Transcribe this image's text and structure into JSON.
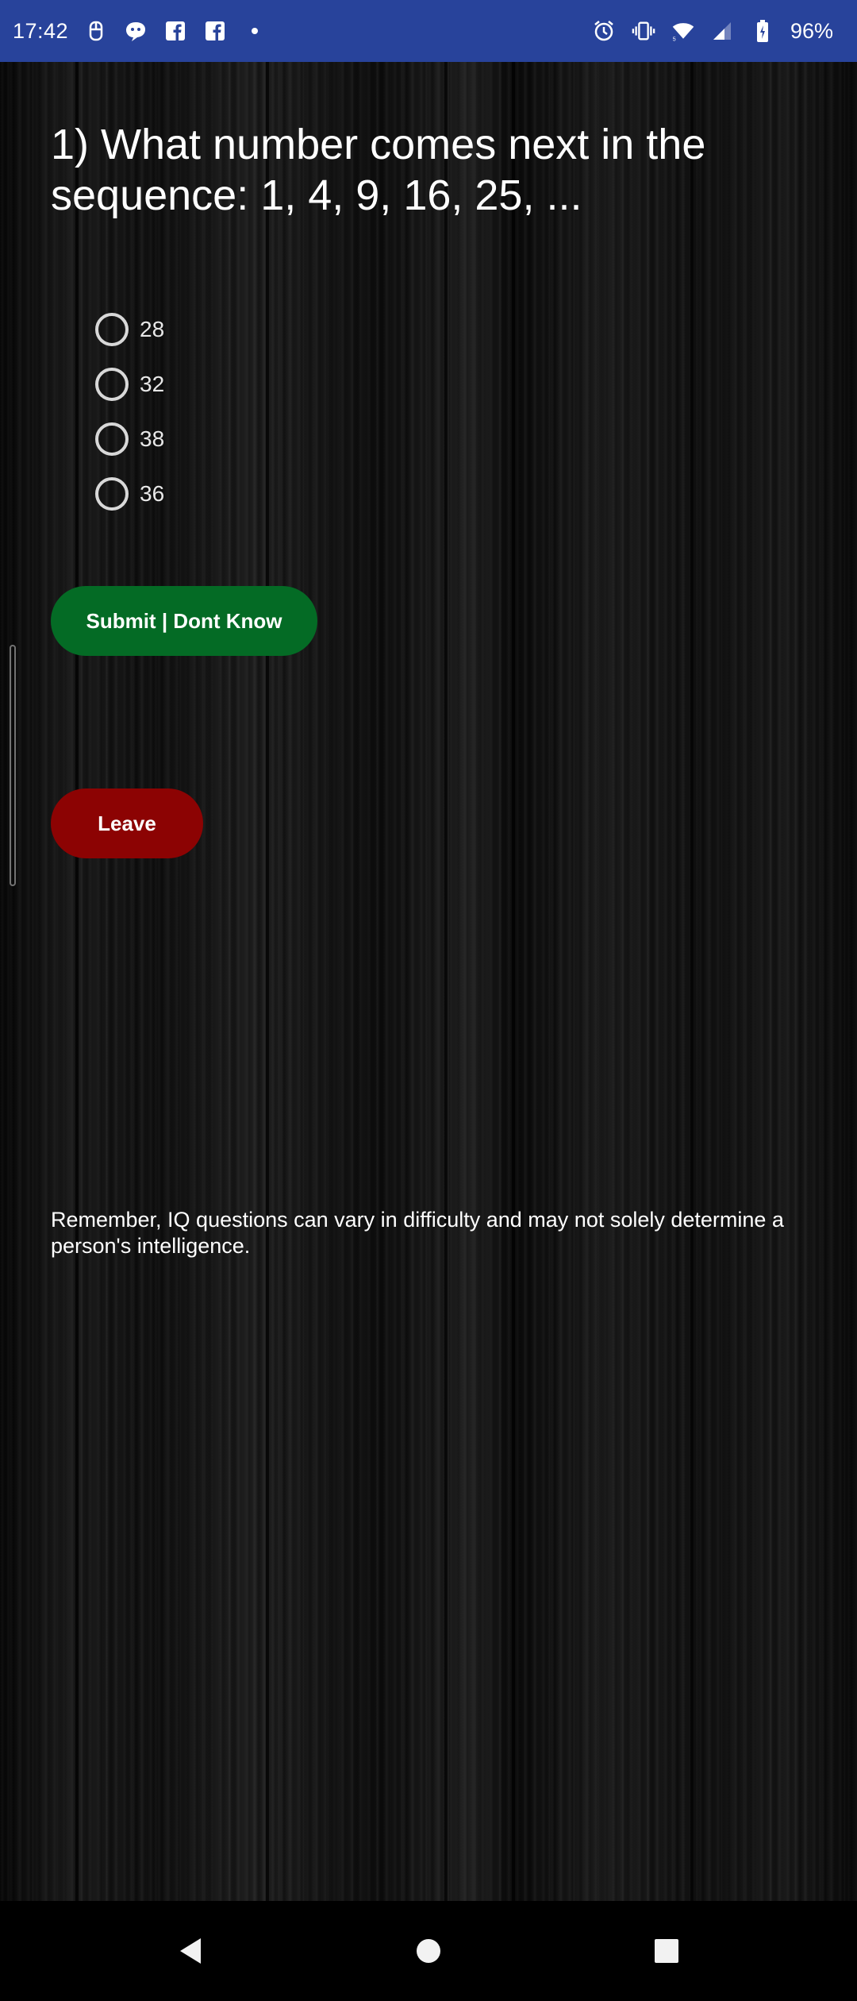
{
  "status_bar": {
    "time": "17:42",
    "battery": "96%",
    "left_icons": [
      "usb-icon",
      "chat-bubble-icon",
      "facebook-icon",
      "facebook-icon",
      "dot-icon"
    ],
    "right_icons": [
      "alarm-icon",
      "vibrate-icon",
      "wifi-icon",
      "signal-icon",
      "battery-icon"
    ]
  },
  "quiz": {
    "question": "1) What number comes next in the sequence: 1, 4, 9, 16, 25, ...",
    "options": [
      {
        "label": "28"
      },
      {
        "label": "32"
      },
      {
        "label": "38"
      },
      {
        "label": "36"
      }
    ],
    "submit_label": "Submit | Dont Know",
    "leave_label": "Leave",
    "note": "Remember, IQ questions can vary in difficulty and may not solely determine a person's intelligence."
  },
  "colors": {
    "status_bar": "#28439b",
    "submit": "#046b25",
    "leave": "#8c0303"
  },
  "nav_bar": {
    "icons": [
      "back-icon",
      "home-icon",
      "recents-icon"
    ]
  }
}
